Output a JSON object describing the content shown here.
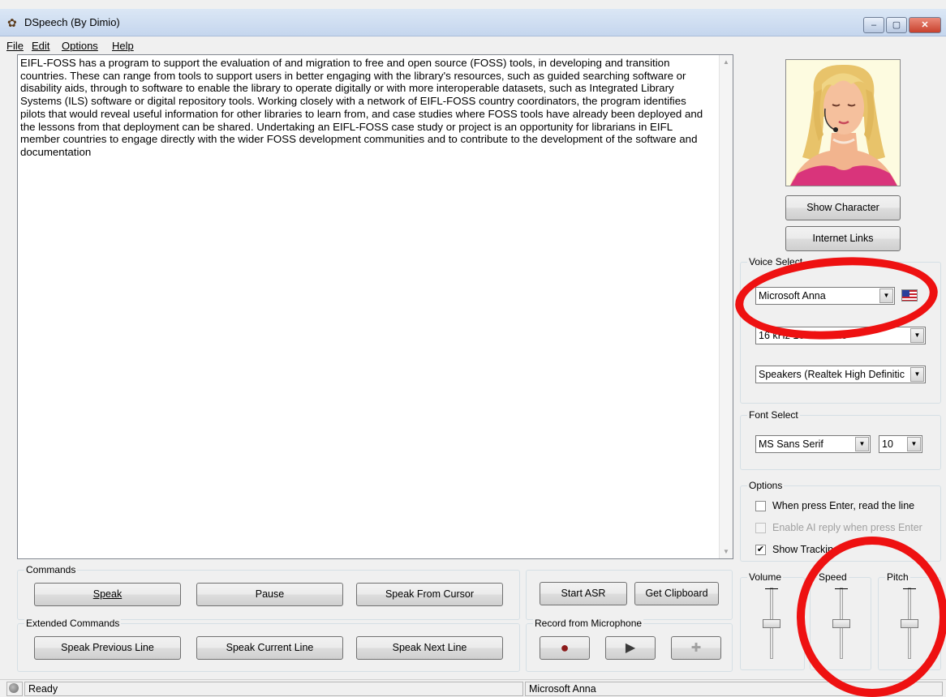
{
  "window": {
    "title": "DSpeech (By Dimio)",
    "controls": [
      "–",
      "▢",
      "✕"
    ]
  },
  "menu": {
    "items": [
      "File",
      "Edit",
      "Options",
      "Help"
    ]
  },
  "editor": {
    "text": "EIFL-FOSS has a program to support the evaluation of and migration to free and open source (FOSS) tools, in developing and transition countries. These can range from tools to support users in better engaging with the library's resources, such as guided searching software or disability aids, through to software to enable the library to operate digitally or with more interoperable datasets, such as Integrated Library Systems (ILS) software or digital repository tools. Working closely with a network of EIFL-FOSS country coordinators, the program identifies pilots that would reveal useful information for other libraries to learn from, and case studies where FOSS tools have already been deployed and the lessons from that deployment can be shared. Undertaking an EIFL-FOSS case study or project is an opportunity for librarians in EIFL member countries to engage directly with the wider FOSS development communities and to contribute to the development of the software and documentation"
  },
  "commands": {
    "legend": "Commands",
    "speak": "Speak",
    "pause": "Pause",
    "speak_from_cursor": "Speak From Cursor"
  },
  "asr": {
    "start": "Start ASR",
    "clipboard": "Get Clipboard"
  },
  "extended": {
    "legend": "Extended Commands",
    "previous": "Speak Previous Line",
    "current": "Speak Current Line",
    "next": "Speak Next Line"
  },
  "record": {
    "legend": "Record from Microphone",
    "record_symbol": "●",
    "play_symbol": "▶",
    "add_symbol": "✚"
  },
  "side": {
    "show_character": "Show Character",
    "internet_links": "Internet Links"
  },
  "voice": {
    "legend": "Voice Select",
    "voice": "Microsoft Anna",
    "format": "16 kHz 16 Bit Mono",
    "output": "Speakers (Realtek High Definitic",
    "dropdown_arrow": "▼"
  },
  "font": {
    "legend": "Font Select",
    "family": "MS Sans Serif",
    "size": "10"
  },
  "options": {
    "legend": "Options",
    "read_line": "When press Enter, read the line",
    "ai_reply": "Enable AI reply when press Enter",
    "show_tracking": "Show Tracking",
    "check_mark": "✔"
  },
  "sliders": {
    "volume_label": "Volume",
    "speed_label": "Speed",
    "pitch_label": "Pitch",
    "volume_level": 0.5,
    "speed_level": 0.5,
    "pitch_level": 0.5
  },
  "status": {
    "state": "Ready",
    "voice": "Microsoft Anna"
  },
  "colors": {
    "annotation_red": "#ee1111",
    "record_dot": "#8b1a1a"
  }
}
